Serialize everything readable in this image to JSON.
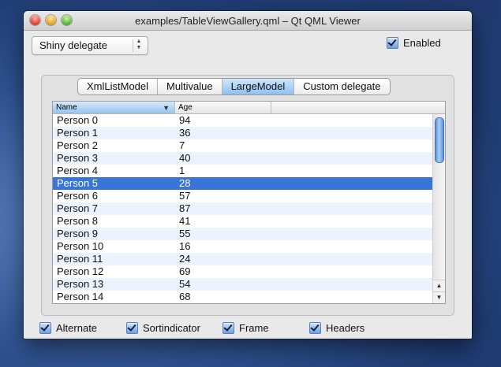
{
  "window": {
    "title": "examples/TableViewGallery.qml – Qt QML Viewer"
  },
  "controls": {
    "delegate_combo": "Shiny delegate",
    "enabled_label": "Enabled"
  },
  "tabs": [
    "XmlListModel",
    "Multivalue",
    "LargeModel",
    "Custom delegate"
  ],
  "active_tab": "LargeModel",
  "table": {
    "headers": {
      "name": "Name",
      "age": "Age"
    },
    "rows": [
      {
        "name": "Person 0",
        "age": "94"
      },
      {
        "name": "Person 1",
        "age": "36"
      },
      {
        "name": "Person 2",
        "age": "7"
      },
      {
        "name": "Person 3",
        "age": "40"
      },
      {
        "name": "Person 4",
        "age": "1"
      },
      {
        "name": "Person 5",
        "age": "28"
      },
      {
        "name": "Person 6",
        "age": "57"
      },
      {
        "name": "Person 7",
        "age": "87"
      },
      {
        "name": "Person 8",
        "age": "41"
      },
      {
        "name": "Person 9",
        "age": "55"
      },
      {
        "name": "Person 10",
        "age": "16"
      },
      {
        "name": "Person 11",
        "age": "24"
      },
      {
        "name": "Person 12",
        "age": "69"
      },
      {
        "name": "Person 13",
        "age": "54"
      },
      {
        "name": "Person 14",
        "age": "68"
      }
    ],
    "selected_row": "Person 5"
  },
  "options": {
    "alternate": "Alternate",
    "sortindicator": "Sortindicator",
    "frame": "Frame",
    "headers": "Headers"
  },
  "colors": {
    "selection": "#3875d7",
    "alternate_row": "#edf3fe"
  }
}
